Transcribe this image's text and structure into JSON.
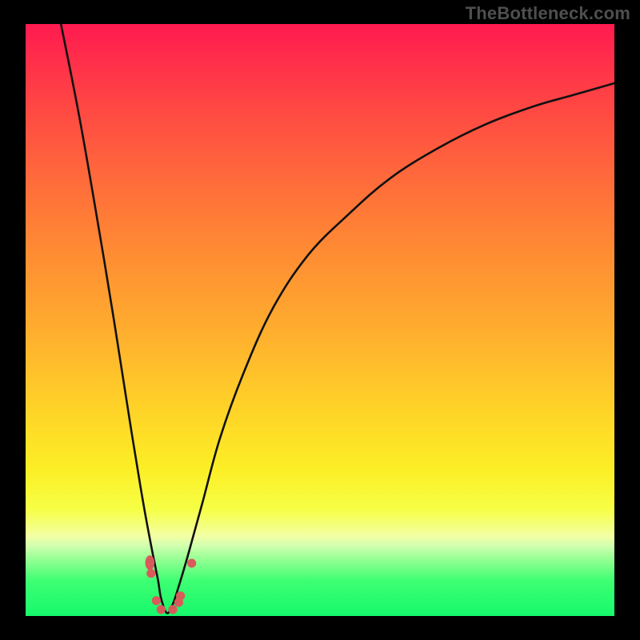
{
  "attribution": {
    "watermark": "TheBottleneck.com"
  },
  "chart_data": {
    "type": "line",
    "title": "",
    "xlabel": "",
    "ylabel": "",
    "xlim": [
      0,
      100
    ],
    "ylim": [
      0,
      100
    ],
    "grid": false,
    "background": "heat-gradient (red high → green low)",
    "notes": "Axes and tick labels are not rendered in the image; values below are read off relative plot-area coordinates (0–100 each axis). y=0 at bottom (green), y=100 at top (red). Single V-shaped curve with sharp minimum near x≈24; left branch from top-left falls steeply, right branch rises and saturates toward top-right.",
    "series": [
      {
        "name": "bottleneck-curve",
        "x": [
          6,
          9,
          12,
          15,
          18,
          20,
          21.5,
          22.5,
          23,
          24,
          25,
          26,
          27.5,
          30,
          33,
          37,
          42,
          48,
          55,
          62,
          70,
          78,
          86,
          93,
          100
        ],
        "y": [
          100,
          85,
          68,
          50,
          31,
          19,
          11,
          6,
          3,
          0.5,
          2,
          5,
          10,
          19,
          30,
          41,
          52,
          61,
          68,
          74,
          79,
          83,
          86,
          88,
          90
        ]
      }
    ],
    "markers": {
      "description": "Salmon dots along inner part of the V near the bottom",
      "points": [
        {
          "x": 21.1,
          "y": 9.0,
          "shape": "oval"
        },
        {
          "x": 21.3,
          "y": 7.2,
          "shape": "dot"
        },
        {
          "x": 22.2,
          "y": 2.6,
          "shape": "dot"
        },
        {
          "x": 23.0,
          "y": 1.1,
          "shape": "dot"
        },
        {
          "x": 25.0,
          "y": 1.1,
          "shape": "dot"
        },
        {
          "x": 26.0,
          "y": 2.3,
          "shape": "dot"
        },
        {
          "x": 26.3,
          "y": 3.4,
          "shape": "dot"
        },
        {
          "x": 28.2,
          "y": 8.9,
          "shape": "dot"
        }
      ]
    },
    "gradient_stops_pct_from_top": {
      "red": 0,
      "orange": 40,
      "yellow": 75,
      "pale": 87,
      "green": 100
    }
  }
}
